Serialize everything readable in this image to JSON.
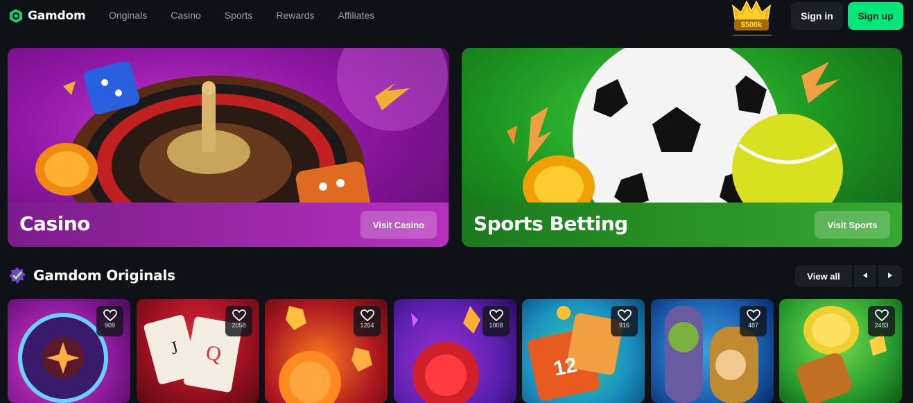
{
  "brand": {
    "name": "Gamdom",
    "accent": "#00e87b"
  },
  "nav": {
    "items": [
      {
        "label": "Originals"
      },
      {
        "label": "Casino"
      },
      {
        "label": "Sports"
      },
      {
        "label": "Rewards"
      },
      {
        "label": "Affiliates"
      }
    ]
  },
  "promo": {
    "badge": "$500k",
    "icon": "crown-icon"
  },
  "auth": {
    "signin_label": "Sign in",
    "signup_label": "Sign up"
  },
  "hero": {
    "casino": {
      "title": "Casino",
      "button_label": "Visit Casino"
    },
    "sports": {
      "title": "Sports Betting",
      "button_label": "Visit Sports"
    }
  },
  "originals": {
    "title": "Gamdom Originals",
    "view_all_label": "View all",
    "prev_icon": "chevron-left-icon",
    "next_icon": "chevron-right-icon",
    "games": [
      {
        "favorites": "909",
        "icon": "heart-icon"
      },
      {
        "favorites": "2058",
        "icon": "heart-icon"
      },
      {
        "favorites": "1264",
        "icon": "heart-icon"
      },
      {
        "favorites": "1008",
        "icon": "heart-icon"
      },
      {
        "favorites": "916",
        "icon": "heart-icon"
      },
      {
        "favorites": "487",
        "icon": "heart-icon"
      },
      {
        "favorites": "2483",
        "icon": "heart-icon"
      }
    ]
  }
}
